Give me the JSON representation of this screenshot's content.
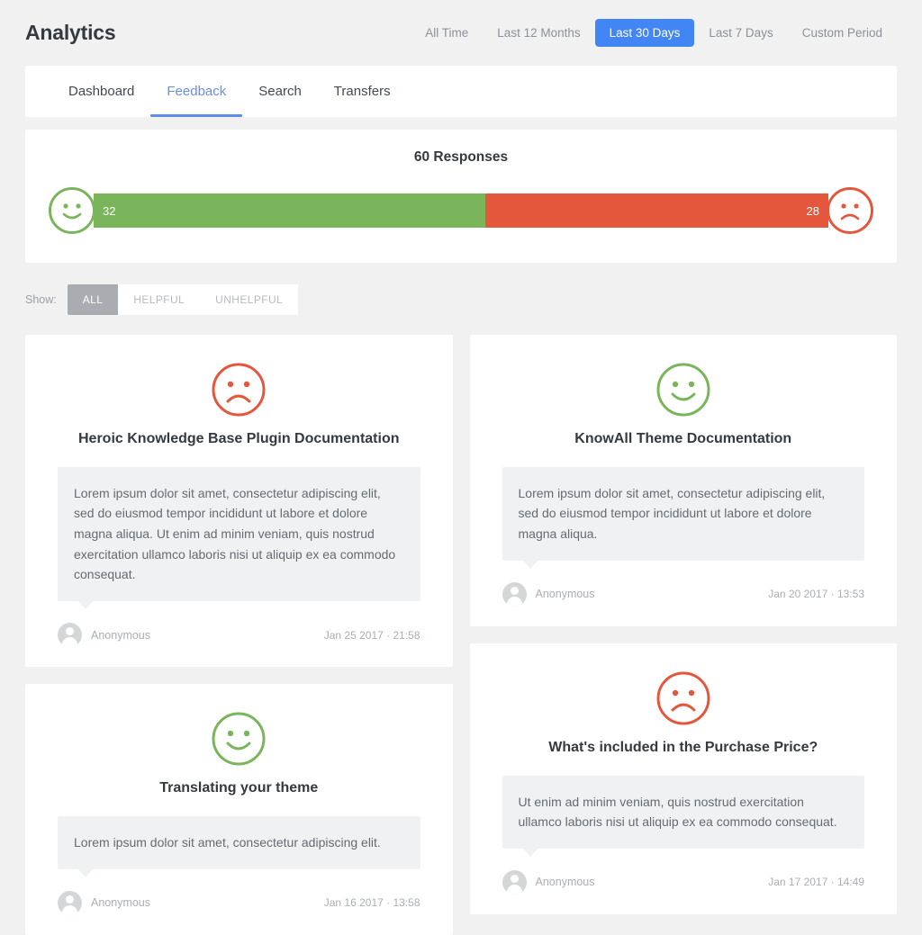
{
  "header": {
    "title": "Analytics",
    "periods": [
      {
        "label": "All Time",
        "active": false
      },
      {
        "label": "Last 12 Months",
        "active": false
      },
      {
        "label": "Last 30 Days",
        "active": true
      },
      {
        "label": "Last 7 Days",
        "active": false
      },
      {
        "label": "Custom Period",
        "active": false
      }
    ]
  },
  "tabs": [
    {
      "label": "Dashboard",
      "active": false
    },
    {
      "label": "Feedback",
      "active": true
    },
    {
      "label": "Search",
      "active": false
    },
    {
      "label": "Transfers",
      "active": false
    }
  ],
  "responses": {
    "title": "60 Responses",
    "positive_count": "32",
    "negative_count": "28",
    "positive_icon": "smiley-happy-icon",
    "negative_icon": "smiley-sad-icon"
  },
  "filters": {
    "label": "Show:",
    "options": [
      {
        "label": "ALL",
        "active": true
      },
      {
        "label": "HELPFUL",
        "active": false
      },
      {
        "label": "UNHELPFUL",
        "active": false
      }
    ]
  },
  "feedback": {
    "left_column": [
      {
        "sentiment": "negative",
        "icon": "smiley-sad-icon",
        "title": "Heroic Knowledge Base Plugin Documentation",
        "comment": "Lorem ipsum dolor sit amet, consectetur adipiscing elit, sed do eiusmod tempor incididunt ut labore et dolore magna aliqua. Ut enim ad minim veniam, quis nostrud exercitation ullamco laboris nisi ut aliquip ex ea commodo consequat.",
        "author": "Anonymous",
        "date": "Jan 25 2017 · 21:58"
      },
      {
        "sentiment": "positive",
        "icon": "smiley-happy-icon",
        "title": "Translating your theme",
        "comment": "Lorem ipsum dolor sit amet, consectetur adipiscing elit.",
        "author": "Anonymous",
        "date": "Jan 16 2017 · 13:58"
      }
    ],
    "right_column": [
      {
        "sentiment": "positive",
        "icon": "smiley-happy-icon",
        "title": "KnowAll Theme Documentation",
        "comment": "Lorem ipsum dolor sit amet, consectetur adipiscing elit, sed do eiusmod tempor incididunt ut labore et dolore magna aliqua.",
        "author": "Anonymous",
        "date": "Jan 20 2017 · 13:53"
      },
      {
        "sentiment": "negative",
        "icon": "smiley-sad-icon",
        "title": "What's included in the Purchase Price?",
        "comment": "Ut enim ad minim veniam, quis nostrud exercitation ullamco laboris nisi ut aliquip ex ea commodo consequat.",
        "author": "Anonymous",
        "date": "Jan 17 2017 · 14:49"
      }
    ]
  },
  "chart_data": {
    "type": "bar",
    "title": "60 Responses",
    "categories": [
      "Helpful",
      "Unhelpful"
    ],
    "values": [
      32,
      28
    ],
    "total": 60,
    "colors": [
      "#7ab55c",
      "#e4573d"
    ],
    "orientation": "horizontal-stacked",
    "xlabel": "",
    "ylabel": "",
    "grid": false,
    "legend": "none"
  },
  "colors": {
    "page_background": "#f1f1f1",
    "card_background": "#ffffff",
    "accent_blue": "#4285f4",
    "tab_active_blue": "#5b8def",
    "positive_green": "#7ab55c",
    "negative_red": "#e4573d",
    "filter_active_grey": "#a9adb2",
    "bubble_grey": "#f0f1f2",
    "title_text": "#343a40",
    "muted_text": "#a9aeb3"
  }
}
